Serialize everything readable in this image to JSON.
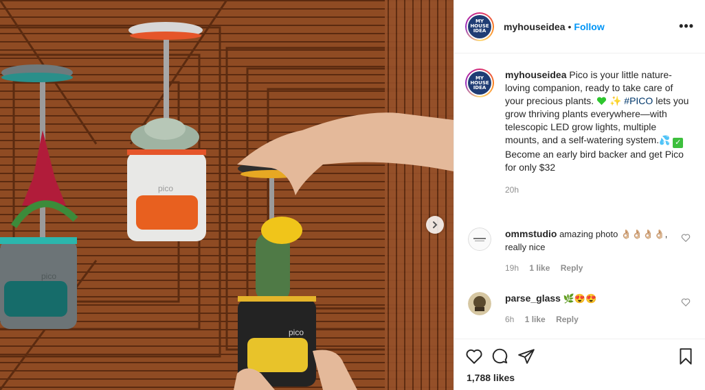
{
  "post": {
    "author": "myhouseidea",
    "follow_label": "Follow",
    "dot": "•",
    "more_label": "•••",
    "avatar_text": [
      "MY",
      "HOUSE",
      "IDEA"
    ],
    "photo_brand": "pico"
  },
  "caption": {
    "username": "myhouseidea",
    "text_1": " Pico is your little nature-loving companion, ready to take care of your precious plants.",
    "hashtag": "#PICO",
    "text_2": " lets you grow thriving plants everywhere—with telescopic LED grow lights, multiple mounts, and a self-watering system.",
    "text_3": "Become an early bird backer and get Pico for only $32",
    "time": "20h"
  },
  "comments": [
    {
      "username": "ommstudio",
      "text": " amazing photo 👌🏼👌🏼👌🏼👌🏼, really nice",
      "time": "19h",
      "likes": "1 like",
      "reply": "Reply"
    },
    {
      "username": "parse_glass",
      "text": " 🌿😍😍",
      "time": "6h",
      "likes": "1 like",
      "reply": "Reply"
    }
  ],
  "footer": {
    "likes": "1,788 likes"
  },
  "colors": {
    "link": "#0095f6",
    "hashtag": "#00376b",
    "muted": "#8e8e8e",
    "text": "#262626"
  },
  "icons": [
    "heart-icon",
    "comment-icon",
    "share-icon",
    "bookmark-icon",
    "chevron-right-icon",
    "more-icon"
  ]
}
